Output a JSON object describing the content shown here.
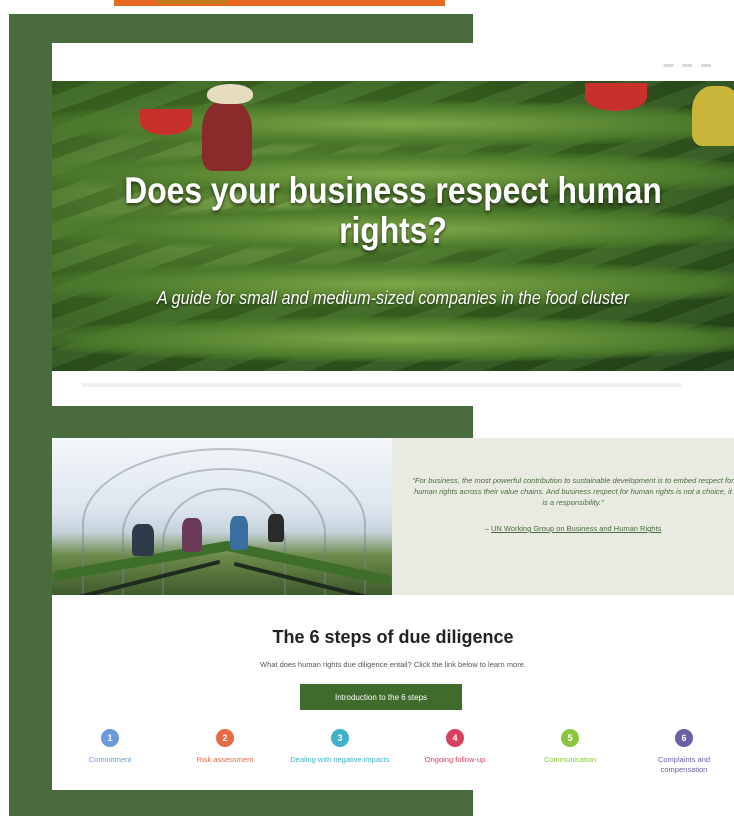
{
  "hero": {
    "title": "Does your business respect human rights?",
    "subtitle": "A guide for small and medium-sized companies in the food cluster"
  },
  "quote": {
    "text": "\"For business, the most powerful contribution to sustainable development is to embed respect for human rights across their value chains. And business respect for human rights is not a choice, it is a responsibility.\"",
    "dash": "– ",
    "source": "UN Working Group on Business and Human Rights"
  },
  "steps_section": {
    "heading": "The 6 steps of due diligence",
    "intro": "What does human rights due diligence entail? Click the link below to learn more.",
    "button_label": "Introduction to the 6 steps",
    "steps": [
      {
        "number": "1",
        "label": "Commitment",
        "color": "#6a9bd8"
      },
      {
        "number": "2",
        "label": "Risk assessment",
        "color": "#e86a44"
      },
      {
        "number": "3",
        "label": "Dealing with negative impacts",
        "color": "#3fb2c9"
      },
      {
        "number": "4",
        "label": "Ongoing follow-up",
        "color": "#d8415e"
      },
      {
        "number": "5",
        "label": "Communication",
        "color": "#8cc641"
      },
      {
        "number": "6",
        "label": "Complaints and compensation",
        "color": "#6d5ea8"
      }
    ]
  },
  "colors": {
    "panel_green": "#4a6b3e",
    "accent_orange": "#e8691f",
    "button_green": "#3f6b2c"
  }
}
